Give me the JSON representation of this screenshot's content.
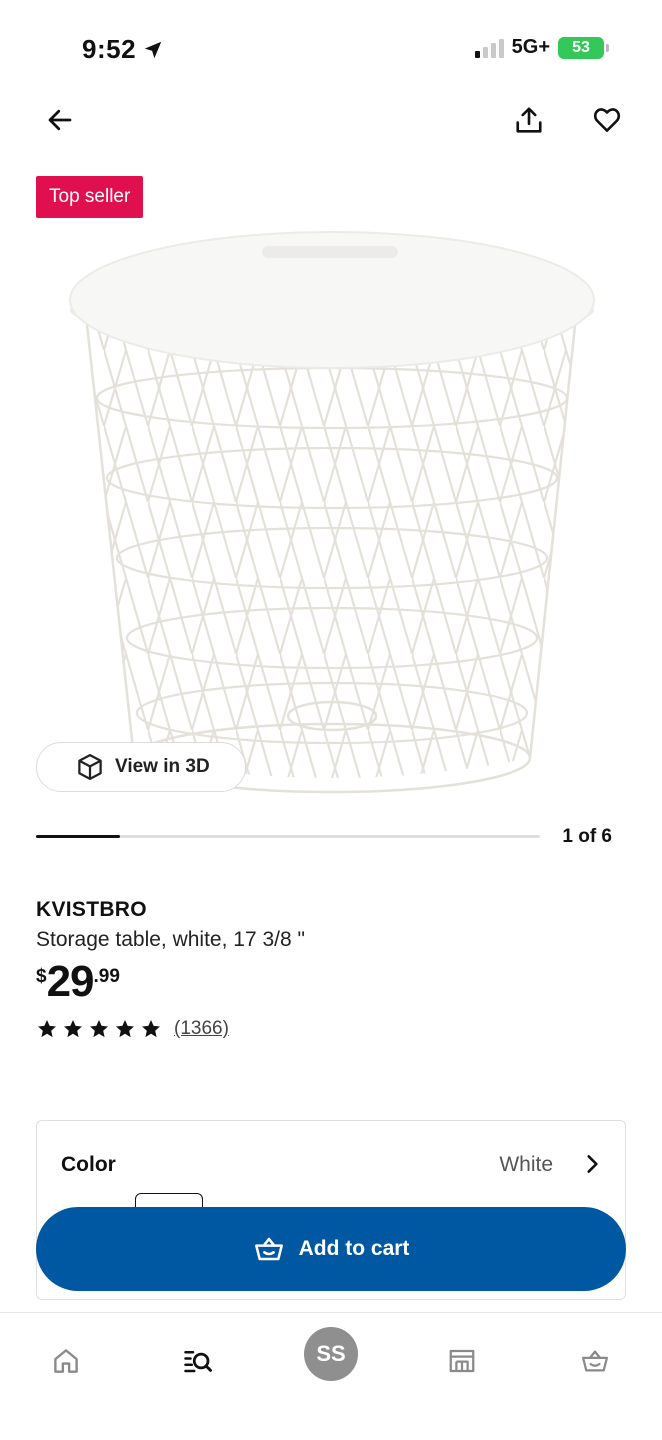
{
  "status_bar": {
    "time": "9:52",
    "network": "5G+",
    "battery": "53",
    "battery_color": "#34c759"
  },
  "nav": {
    "back_icon": "arrow-left-icon",
    "share_icon": "share-icon",
    "favorite_icon": "heart-icon"
  },
  "gallery": {
    "badge": "Top seller",
    "badge_color": "#e0104f",
    "view_3d_label": "View in 3D",
    "pager_text": "1 of 6",
    "current_image": 1,
    "total_images": 6
  },
  "product": {
    "name": "KVISTBRO",
    "description": "Storage table, white, 17 3/8 \"",
    "price_currency": "$",
    "price_integer": "29",
    "price_decimal": ".99",
    "rating": 5,
    "review_count": "(1366)"
  },
  "color_selector": {
    "label": "Color",
    "value": "White"
  },
  "cta": {
    "add_to_cart_label": "Add to cart",
    "button_color": "#0058a3"
  },
  "tabbar": {
    "items": [
      {
        "name": "home",
        "icon": "home-icon"
      },
      {
        "name": "search",
        "icon": "search-list-icon"
      },
      {
        "name": "profile",
        "initials": "SS"
      },
      {
        "name": "stores",
        "icon": "store-icon"
      },
      {
        "name": "cart",
        "icon": "basket-icon"
      }
    ]
  }
}
